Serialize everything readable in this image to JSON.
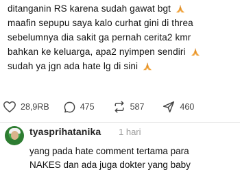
{
  "post": {
    "lines": [
      "ditanganin RS karena sudah gawat bgt",
      "maafin sepupu saya kalo curhat gini di threa",
      "sebelumnya dia sakit ga pernah cerita2 kmr",
      "bahkan ke keluarga, apa2 nyimpen sendiri",
      "sudah ya jgn ada hate lg di sini"
    ],
    "emoji_icon": "folded-hands-icon"
  },
  "actions": {
    "likes": "28,9RB",
    "comments": "475",
    "reposts": "587",
    "shares": "460",
    "icons": [
      "heart-icon",
      "comment-bubble-icon",
      "repost-icon",
      "share-arrow-icon"
    ]
  },
  "comment": {
    "username": "tyasprihatanika",
    "time": "1 hari",
    "lines": [
      "yang pada hate comment tertama para",
      "NAKES dan ada juga dokter yang baby"
    ],
    "avatar_icon": "avatar"
  },
  "colors": {
    "text": "#111111",
    "muted": "#9a9a9a",
    "emoji": "#f2a33a"
  }
}
